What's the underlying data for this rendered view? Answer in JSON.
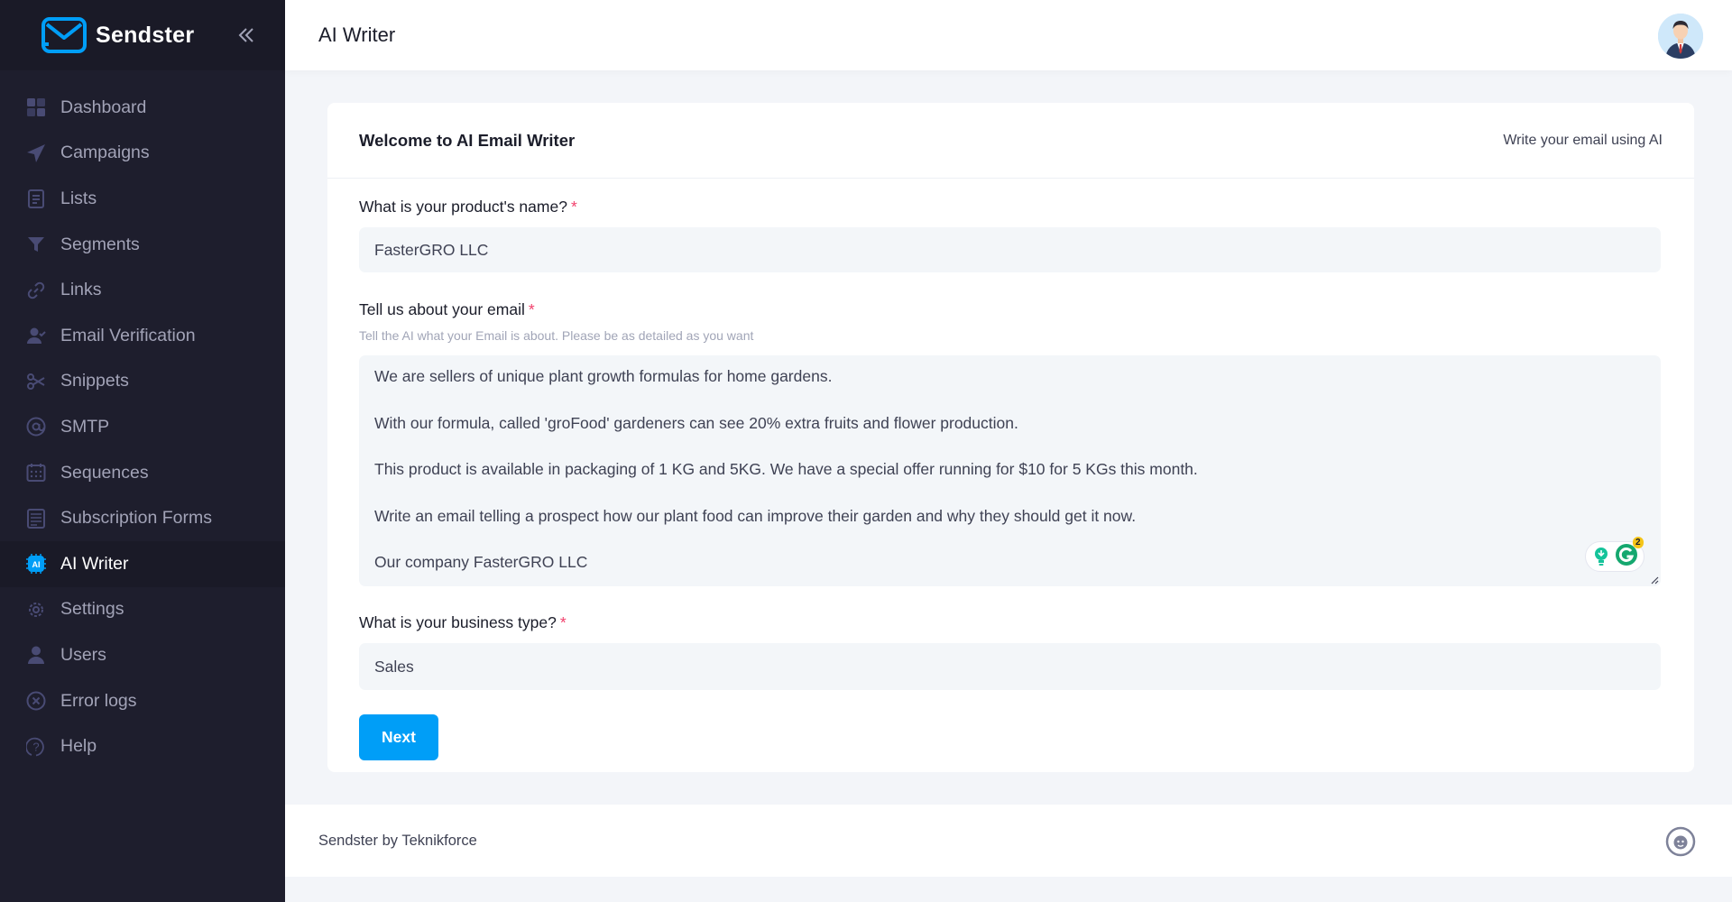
{
  "brand": {
    "name": "Sendster",
    "accent": "#009ef7",
    "sidebar_bg": "#1e1e2d"
  },
  "sidebar": {
    "items": [
      {
        "label": "Dashboard",
        "icon": "dashboard-icon"
      },
      {
        "label": "Campaigns",
        "icon": "send-icon"
      },
      {
        "label": "Lists",
        "icon": "clipboard-list-icon"
      },
      {
        "label": "Segments",
        "icon": "filter-icon"
      },
      {
        "label": "Links",
        "icon": "link-icon"
      },
      {
        "label": "Email Verification",
        "icon": "user-check-icon"
      },
      {
        "label": "Snippets",
        "icon": "scissors-icon"
      },
      {
        "label": "SMTP",
        "icon": "at-sign-icon"
      },
      {
        "label": "Sequences",
        "icon": "calendar-icon"
      },
      {
        "label": "Subscription Forms",
        "icon": "form-icon"
      },
      {
        "label": "AI Writer",
        "icon": "ai-chip-icon",
        "active": true
      },
      {
        "label": "Settings",
        "icon": "gear-icon"
      },
      {
        "label": "Users",
        "icon": "user-icon"
      },
      {
        "label": "Error logs",
        "icon": "error-circle-icon"
      },
      {
        "label": "Help",
        "icon": "help-icon"
      }
    ]
  },
  "header": {
    "title": "AI Writer"
  },
  "card": {
    "title": "Welcome to AI Email Writer",
    "toolbar_text": "Write your email using AI",
    "fields": {
      "product_name": {
        "label": "What is your product's name?",
        "required": "*",
        "value": "FasterGRO LLC"
      },
      "email_about": {
        "label": "Tell us about your email",
        "required": "*",
        "hint": "Tell the AI what your Email is about. Please be as detailed as you want",
        "paragraphs": [
          "We are sellers of unique plant growth formulas for home gardens.",
          "With our formula, called 'groFood' gardeners can see 20% extra fruits and flower production.",
          "This product is available in packaging of 1 KG and 5KG. We have a special offer running for $10 for 5 KGs this month.",
          "Write an email telling a prospect how our plant food can improve their garden and why they should get it now.",
          "Our company FasterGRO LLC"
        ],
        "grammarly_count": "2"
      },
      "business_type": {
        "label": "What is your business type?",
        "required": "*",
        "value": "Sales"
      }
    },
    "next_label": "Next"
  },
  "footer": {
    "text": "Sendster by Teknikforce"
  }
}
